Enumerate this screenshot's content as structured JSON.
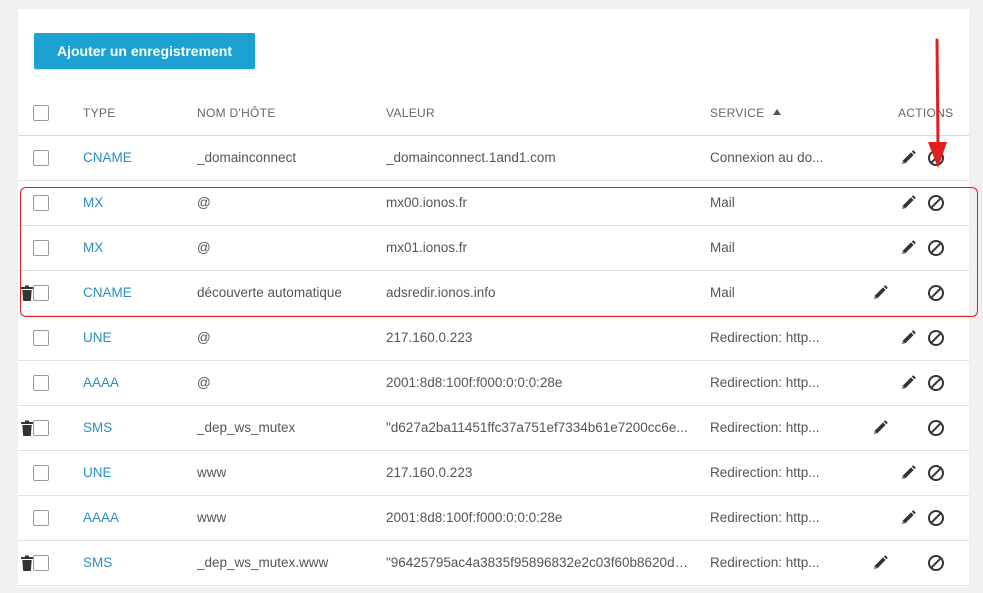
{
  "add_button_label": "Ajouter un enregistrement",
  "columns": {
    "type": "TYPE",
    "host": "NOM D'HÔTE",
    "value": "VALEUR",
    "service": "SERVICE",
    "actions": "ACTIONS"
  },
  "rows": [
    {
      "type": "CNAME",
      "host": "_domainconnect",
      "value": "_domainconnect.1and1.com",
      "service": "Connexion au do...",
      "actions": [
        "edit",
        "block"
      ]
    },
    {
      "type": "MX",
      "host": "@",
      "value": "mx00.ionos.fr",
      "service": "Mail",
      "actions": [
        "edit",
        "block"
      ]
    },
    {
      "type": "MX",
      "host": "@",
      "value": "mx01.ionos.fr",
      "service": "Mail",
      "actions": [
        "edit",
        "block"
      ]
    },
    {
      "type": "CNAME",
      "host": "découverte automatique",
      "value": "adsredir.ionos.info",
      "service": "Mail",
      "actions": [
        "edit",
        "delete",
        "block"
      ]
    },
    {
      "type": "UNE",
      "host": "@",
      "value": "217.160.0.223",
      "service": "Redirection: http...",
      "actions": [
        "edit",
        "block"
      ]
    },
    {
      "type": "AAAA",
      "host": "@",
      "value": "2001:8d8:100f:f000:0:0:0:28e",
      "service": "Redirection: http...",
      "actions": [
        "edit",
        "block"
      ]
    },
    {
      "type": "SMS",
      "host": "_dep_ws_mutex",
      "value": "\"d627a2ba11451ffc37a751ef7334b61e7200cc6e...",
      "service": "Redirection: http...",
      "actions": [
        "edit",
        "delete",
        "block"
      ]
    },
    {
      "type": "UNE",
      "host": "www",
      "value": "217.160.0.223",
      "service": "Redirection: http...",
      "actions": [
        "edit",
        "block"
      ]
    },
    {
      "type": "AAAA",
      "host": "www",
      "value": "2001:8d8:100f:f000:0:0:0:28e",
      "service": "Redirection: http...",
      "actions": [
        "edit",
        "block"
      ]
    },
    {
      "type": "SMS",
      "host": "_dep_ws_mutex.www",
      "value": "\"96425795ac4a3835f95896832e2c03f60b8620da...",
      "service": "Redirection: http...",
      "actions": [
        "edit",
        "delete",
        "block"
      ]
    }
  ],
  "colors": {
    "accent": "#1ba1d2",
    "type_link": "#2b8dbf",
    "annotation_red": "#e02020"
  },
  "icons": {
    "edit": "pencil-icon",
    "delete": "trash-icon",
    "block": "block-icon",
    "sort": "sort-ascending-icon"
  }
}
